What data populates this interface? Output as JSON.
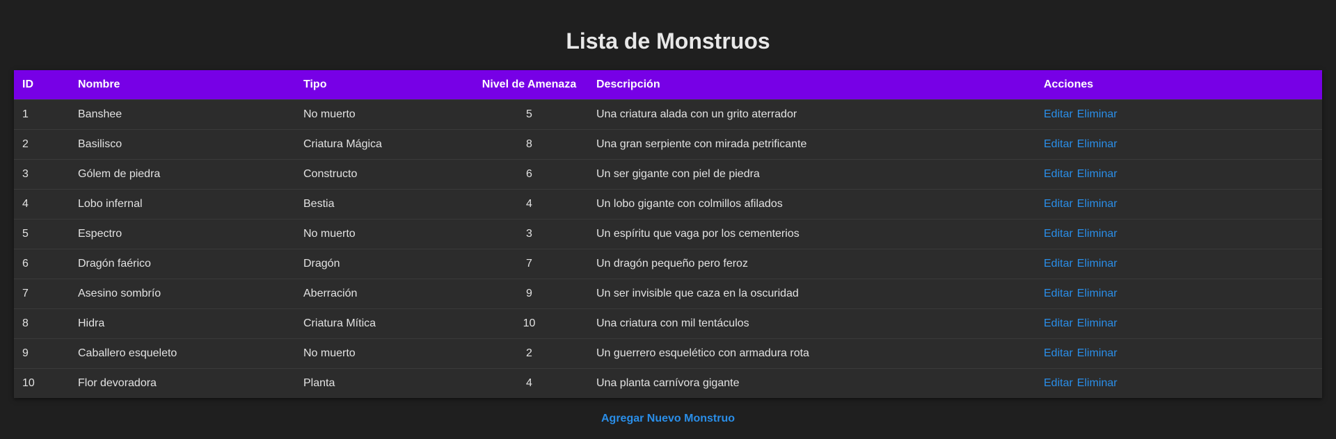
{
  "page": {
    "title": "Lista de Monstruos"
  },
  "table": {
    "headers": [
      "ID",
      "Nombre",
      "Tipo",
      "Nivel de Amenaza",
      "Descripción",
      "Acciones"
    ],
    "actions": {
      "edit_label": "Editar",
      "delete_label": "Eliminar"
    },
    "rows": [
      {
        "id": "1",
        "name": "Banshee",
        "type": "No muerto",
        "threat": "5",
        "description": "Una criatura alada con un grito aterrador"
      },
      {
        "id": "2",
        "name": "Basilisco",
        "type": "Criatura Mágica",
        "threat": "8",
        "description": "Una gran serpiente con mirada petrificante"
      },
      {
        "id": "3",
        "name": "Gólem de piedra",
        "type": "Constructo",
        "threat": "6",
        "description": "Un ser gigante con piel de piedra"
      },
      {
        "id": "4",
        "name": "Lobo infernal",
        "type": "Bestia",
        "threat": "4",
        "description": "Un lobo gigante con colmillos afilados"
      },
      {
        "id": "5",
        "name": "Espectro",
        "type": "No muerto",
        "threat": "3",
        "description": "Un espíritu que vaga por los cementerios"
      },
      {
        "id": "6",
        "name": "Dragón faérico",
        "type": "Dragón",
        "threat": "7",
        "description": "Un dragón pequeño pero feroz"
      },
      {
        "id": "7",
        "name": "Asesino sombrío",
        "type": "Aberración",
        "threat": "9",
        "description": "Un ser invisible que caza en la oscuridad"
      },
      {
        "id": "8",
        "name": "Hidra",
        "type": "Criatura Mítica",
        "threat": "10",
        "description": "Una criatura con mil tentáculos"
      },
      {
        "id": "9",
        "name": "Caballero esqueleto",
        "type": "No muerto",
        "threat": "2",
        "description": "Un guerrero esquelético con armadura rota"
      },
      {
        "id": "10",
        "name": "Flor devoradora",
        "type": "Planta",
        "threat": "4",
        "description": "Una planta carnívora gigante"
      }
    ]
  },
  "footer": {
    "add_label": "Agregar Nuevo Monstruo"
  },
  "colors": {
    "background": "#1f1f1f",
    "header": "#7700e6",
    "row": "#2c2c2c",
    "link": "#2a8ee8"
  }
}
